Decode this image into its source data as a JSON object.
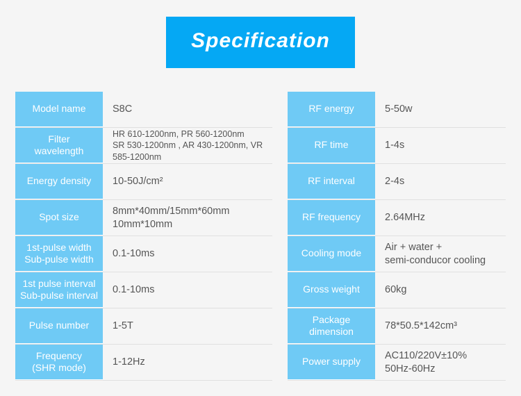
{
  "title": "Specification",
  "left": [
    {
      "label": "Model name",
      "value": "S8C"
    },
    {
      "label": "Filter\nwavelength",
      "value": "HR 610-1200nm,  PR 560-1200nm\nSR 530-1200nm , AR 430-1200nm, VR 585-1200nm",
      "small": true
    },
    {
      "label": "Energy density",
      "value": "10-50J/cm²"
    },
    {
      "label": "Spot size",
      "value": "8mm*40mm/15mm*60mm\n10mm*10mm"
    },
    {
      "label": "1st-pulse width\nSub-pulse width",
      "value": "0.1-10ms"
    },
    {
      "label": "1st pulse interval\nSub-pulse interval",
      "value": "0.1-10ms"
    },
    {
      "label": "Pulse number",
      "value": "1-5T"
    },
    {
      "label": "Frequency\n(SHR mode)",
      "value": "1-12Hz"
    }
  ],
  "right": [
    {
      "label": "RF energy",
      "value": "5-50w"
    },
    {
      "label": "RF time",
      "value": "1-4s"
    },
    {
      "label": "RF interval",
      "value": "2-4s"
    },
    {
      "label": "RF frequency",
      "value": "2.64MHz"
    },
    {
      "label": "Cooling mode",
      "value": "Air + water +\nsemi-conducor cooling"
    },
    {
      "label": "Gross weight",
      "value": "60kg"
    },
    {
      "label": "Package\ndimension",
      "value": "78*50.5*142cm³"
    },
    {
      "label": "Power supply",
      "value": "AC110/220V±10%\n50Hz-60Hz"
    }
  ]
}
